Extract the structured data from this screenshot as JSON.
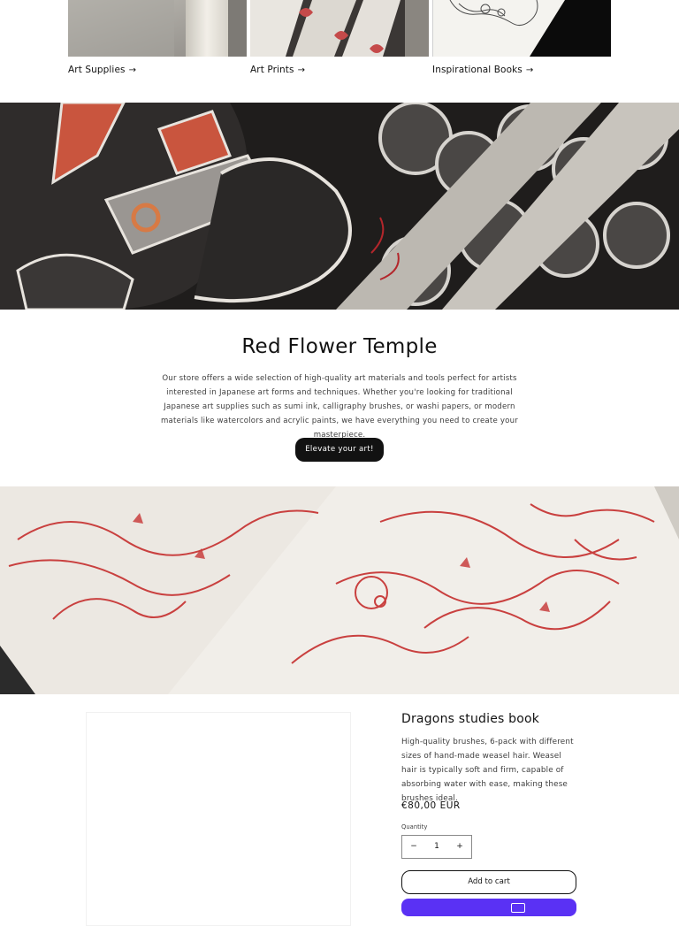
{
  "collections": [
    {
      "label": "Art Supplies",
      "arrow": "→"
    },
    {
      "label": "Art Prints",
      "arrow": "→"
    },
    {
      "label": "Inspirational Books",
      "arrow": "→"
    }
  ],
  "rich_text": {
    "title": "Red Flower Temple",
    "body": "Our store offers a wide selection of high-quality art materials and tools perfect for artists interested in Japanese art forms and techniques. Whether you're looking for traditional Japanese art supplies such as sumi ink, calligraphy brushes, or washi papers, or modern materials like watercolors and acrylic paints, we have everything you need to create your masterpiece.",
    "button": "Elevate your art!"
  },
  "product": {
    "title": "Dragons studies book",
    "description": "High-quality brushes, 6-pack with different sizes of hand-made weasel hair. Weasel hair is typically soft and firm, capable of absorbing water with ease, making these brushes ideal.",
    "price": "€80,00 EUR",
    "quantity_label": "Quantity",
    "quantity_value": "1",
    "minus": "−",
    "plus": "+",
    "add_to_cart": "Add to cart"
  },
  "colors": {
    "text": "#121212",
    "accent_button": "#121212",
    "shop_pay": "#5a31f4",
    "ink_red": "#c9553e"
  },
  "icons": {
    "collection_arrow": "arrow-right-icon",
    "shop_pay": "shop-pay-icon"
  }
}
